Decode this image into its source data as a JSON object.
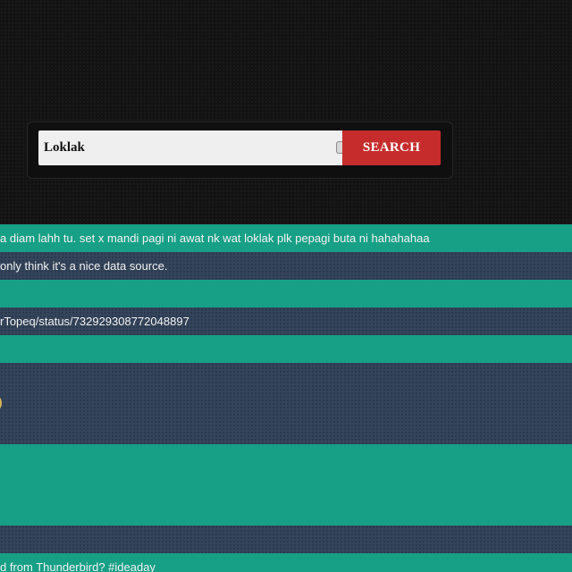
{
  "search": {
    "value": "Loklak",
    "button_label": "SEARCH"
  },
  "results": [
    {
      "text": "a diam lahh tu. set x mandi pagi ni awat nk wat loklak plk pepagi buta ni hahahahaa"
    },
    {
      "text": " only think it's a nice data source."
    },
    {
      "text": ""
    },
    {
      "text": "rTopeq/status/732929308772048897"
    },
    {
      "text": ""
    },
    {
      "text": ""
    },
    {
      "text": ""
    },
    {
      "text": ""
    },
    {
      "text": "d from Thunderbird? #ideaday"
    }
  ],
  "colors": {
    "background": "#131313",
    "row_green": "#17a086",
    "row_slate": "#34445a",
    "button_red": "#c62c2c"
  }
}
